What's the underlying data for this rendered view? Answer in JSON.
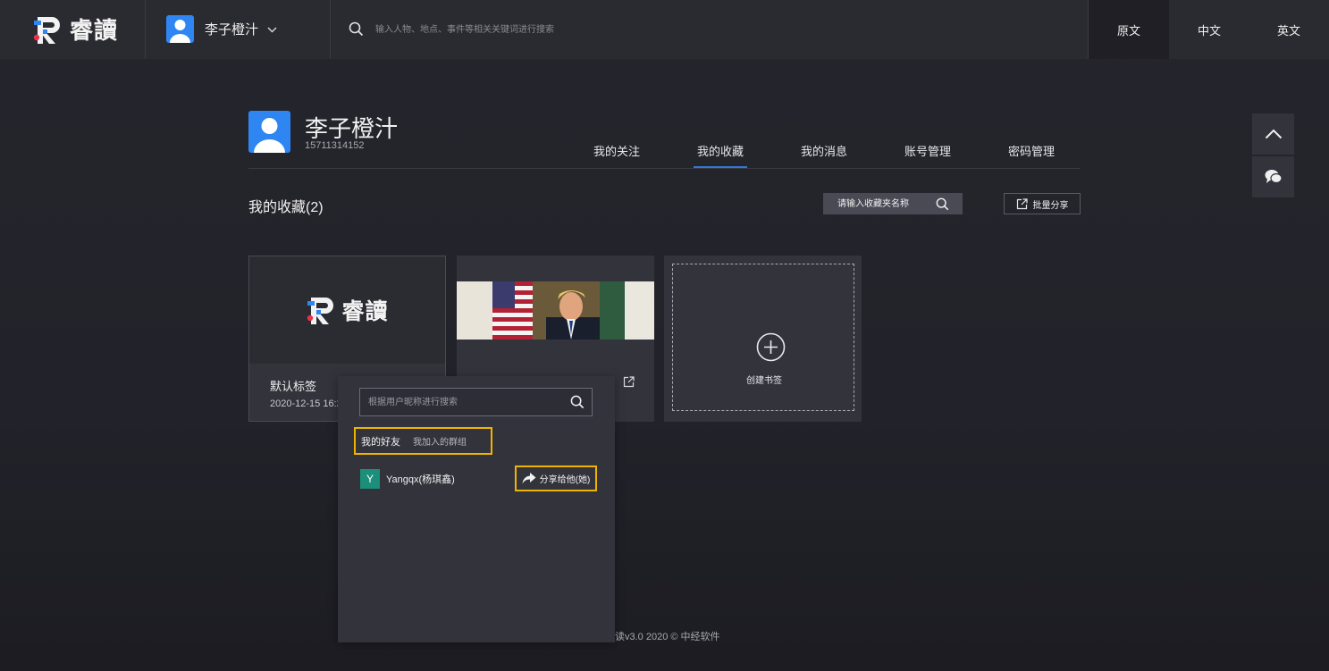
{
  "header": {
    "logo_text": "睿讀",
    "user_name": "李子橙汁",
    "search_placeholder": "输入人物、地点、事件等相关关键词进行搜索",
    "languages": [
      "原文",
      "中文",
      "英文"
    ],
    "active_language": "原文"
  },
  "profile": {
    "name": "李子橙汁",
    "phone": "15711314152",
    "nav": [
      "我的关注",
      "我的收藏",
      "我的消息",
      "账号管理",
      "密码管理"
    ],
    "active_nav": "我的收藏"
  },
  "favorites": {
    "title": "我的收藏(2)",
    "search_placeholder": "请输入收藏夹名称",
    "batch_share_label": "批量分享",
    "cards": [
      {
        "logo_text": "睿讀",
        "title": "默认标签",
        "date": "2020-12-15 16:2"
      },
      {
        "image_desc": "photo"
      }
    ],
    "create_label": "创建书签"
  },
  "share_popup": {
    "search_placeholder": "根据用户昵称进行搜索",
    "tab_friends": "我的好友",
    "tab_groups": "我加入的群组",
    "friends": [
      {
        "initial": "Y",
        "name": "Yangqx(杨琪鑫)"
      }
    ],
    "share_button_label": "分享给他(她)"
  },
  "footer": {
    "text": "读v3.0 2020 © 中经软件"
  },
  "colors": {
    "accent_blue": "#2f86f2",
    "highlight_yellow": "#f0b400",
    "friend_avatar": "#1b8f7a",
    "tab_underline": "#3476d6"
  }
}
